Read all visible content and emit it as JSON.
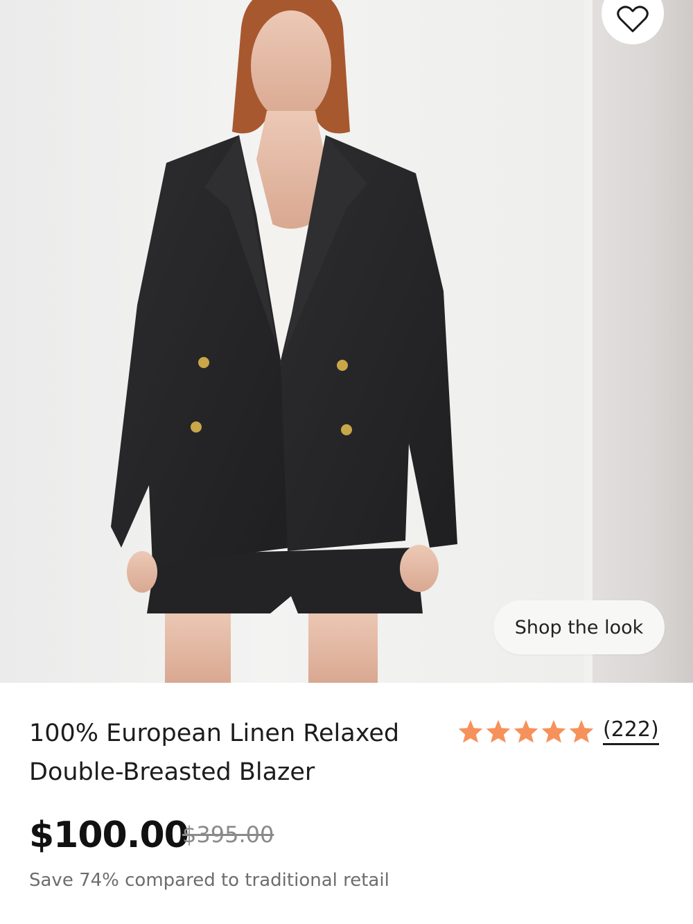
{
  "gallery": {
    "main_image_alt": "Model wearing a black linen double-breasted blazer with gold buttons over a white tank and black shorts",
    "shop_the_look_label": "Shop the look"
  },
  "wishlist": {
    "icon": "heart-icon"
  },
  "product": {
    "title": "100% European Linen Relaxed Double-Breasted Blazer",
    "rating": {
      "stars": 5,
      "count_label": "(222)",
      "star_color": "#F6915B"
    },
    "price": "$100.00",
    "compare_price": "$395.00",
    "savings_text": "Save 74% compared to traditional retail"
  }
}
